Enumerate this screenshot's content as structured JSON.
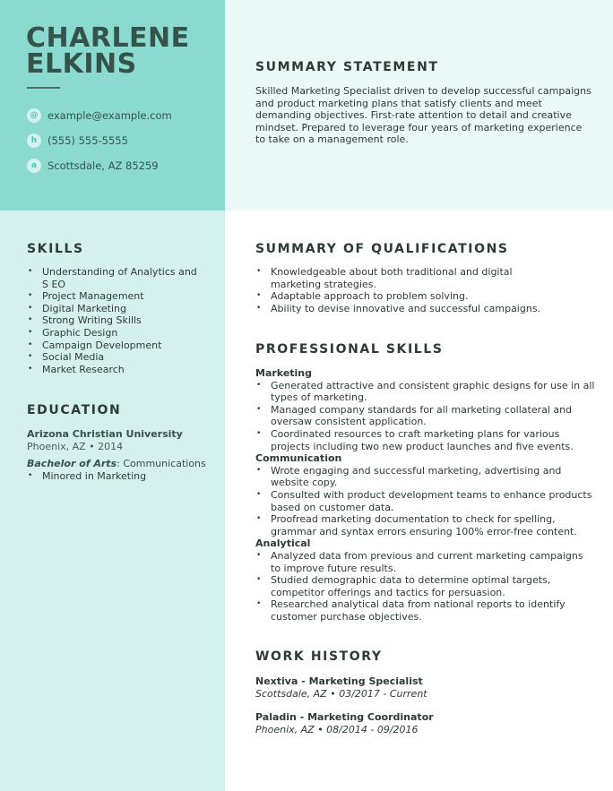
{
  "colors": {
    "header_left": "#8adad0",
    "header_right": "#eaf8f6",
    "sidebar": "#d5f1ee",
    "main": "#ffffff",
    "name_text": "#34534b",
    "icon_accent": "#4fbfb1"
  },
  "header": {
    "first_name": "CHARLENE",
    "last_name": "ELKINS"
  },
  "contact": [
    {
      "icon": "email-icon",
      "glyph": "@",
      "text": "example@example.com"
    },
    {
      "icon": "phone-icon",
      "glyph": "h",
      "text": "(555) 555-5555"
    },
    {
      "icon": "address-icon",
      "glyph": "a",
      "text": "Scottsdale, AZ 85259"
    }
  ],
  "summary": {
    "title": "SUMMARY STATEMENT",
    "text": "Skilled Marketing Specialist driven to develop successful campaigns and product marketing plans that satisfy clients and meet demanding objectives. First-rate attention to detail and creative mindset. Prepared to leverage four years of marketing experience to take on a management role."
  },
  "skills": {
    "title": "SKILLS",
    "items": [
      "Understanding of Analytics and S EO",
      "Project Management",
      "Digital Marketing",
      "Strong Writing Skills",
      "Graphic Design",
      "Campaign Development",
      "Social Media",
      "Market Research"
    ]
  },
  "education": {
    "title": "EDUCATION",
    "school": "Arizona Christian University",
    "location": "Phoenix, AZ  •  2014",
    "degree": "Bachelor of Arts",
    "field": ": Communications",
    "details": [
      "Minored in Marketing"
    ]
  },
  "qualifications": {
    "title": "SUMMARY OF QUALIFICATIONS",
    "items": [
      "Knowledgeable about both traditional and digital marketing strategies.",
      "Adaptable approach to problem solving.",
      "Ability to devise innovative and successful campaigns."
    ]
  },
  "professional_skills": {
    "title": "PROFESSIONAL SKILLS",
    "groups": [
      {
        "name": "Marketing",
        "items": [
          "Generated attractive and consistent graphic designs for use in all types of marketing.",
          "Managed company standards for all marketing collateral and oversaw consistent application.",
          "Coordinated resources to craft marketing plans for various projects including two new product launches and five events."
        ]
      },
      {
        "name": "Communication",
        "items": [
          "Wrote engaging and successful marketing, advertising and website copy.",
          "Consulted with product development teams to enhance products based on customer data.",
          "Proofread marketing documentation to check for spelling, grammar and syntax errors ensuring 100% error-free content."
        ]
      },
      {
        "name": "Analytical",
        "items": [
          "Analyzed data from previous and current marketing campaigns to improve future results.",
          "Studied demographic data to determine optimal targets, competitor offerings and tactics for persuasion.",
          "Researched analytical data from national reports to identify customer purchase objectives."
        ]
      }
    ]
  },
  "work_history": {
    "title": "WORK HISTORY",
    "jobs": [
      {
        "title": "Nextiva - Marketing Specialist",
        "meta": "Scottsdale, AZ  •  03/2017 - Current"
      },
      {
        "title": "Paladin - Marketing Coordinator",
        "meta": "Phoenix, AZ  •  08/2014 - 09/2016"
      }
    ]
  }
}
